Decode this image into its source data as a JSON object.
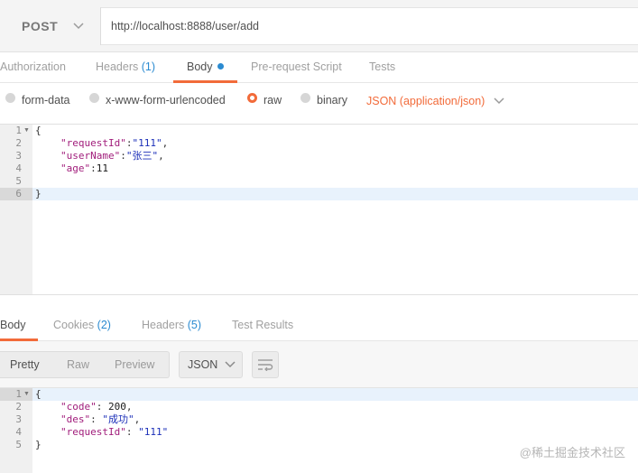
{
  "request": {
    "method": "POST",
    "url": "http://localhost:8888/user/add"
  },
  "request_tabs": [
    {
      "label": "Authorization",
      "count": ""
    },
    {
      "label": "Headers",
      "count": "(1)"
    },
    {
      "label": "Body",
      "count": ""
    },
    {
      "label": "Pre-request Script",
      "count": ""
    },
    {
      "label": "Tests",
      "count": ""
    }
  ],
  "body_types": {
    "options": [
      "form-data",
      "x-www-form-urlencoded",
      "raw",
      "binary"
    ],
    "selected": "raw",
    "content_type": "JSON (application/json)"
  },
  "request_editor": {
    "line_numbers": [
      "1",
      "2",
      "3",
      "4",
      "5",
      "6"
    ],
    "lines": [
      {
        "open": "{"
      },
      {
        "key": "\"requestId\"",
        "sep": ":",
        "value": "\"111\"",
        "end": ","
      },
      {
        "key": "\"userName\"",
        "sep": ":",
        "value": "\"张三\"",
        "end": ","
      },
      {
        "key": "\"age\"",
        "sep": ":",
        "value": "11",
        "end": ""
      },
      {},
      {
        "close": "}"
      }
    ]
  },
  "response_tabs": [
    {
      "label": "Body",
      "count": ""
    },
    {
      "label": "Cookies",
      "count": "(2)"
    },
    {
      "label": "Headers",
      "count": "(5)"
    },
    {
      "label": "Test Results",
      "count": ""
    }
  ],
  "response_toolbar": {
    "views": [
      "Pretty",
      "Raw",
      "Preview"
    ],
    "format": "JSON"
  },
  "response_editor": {
    "line_numbers": [
      "1",
      "2",
      "3",
      "4",
      "5"
    ],
    "lines": [
      {
        "open": "{"
      },
      {
        "key": "\"code\"",
        "sep": ": ",
        "value": "200",
        "end": ","
      },
      {
        "key": "\"des\"",
        "sep": ": ",
        "value": "\"成功\"",
        "end": ","
      },
      {
        "key": "\"requestId\"",
        "sep": ": ",
        "value": "\"111\"",
        "end": ""
      },
      {
        "close": "}"
      }
    ]
  },
  "watermark": "@稀土掘金技术社区",
  "colors": {
    "accent": "#f26b3a",
    "link_blue": "#2b8bd1"
  }
}
